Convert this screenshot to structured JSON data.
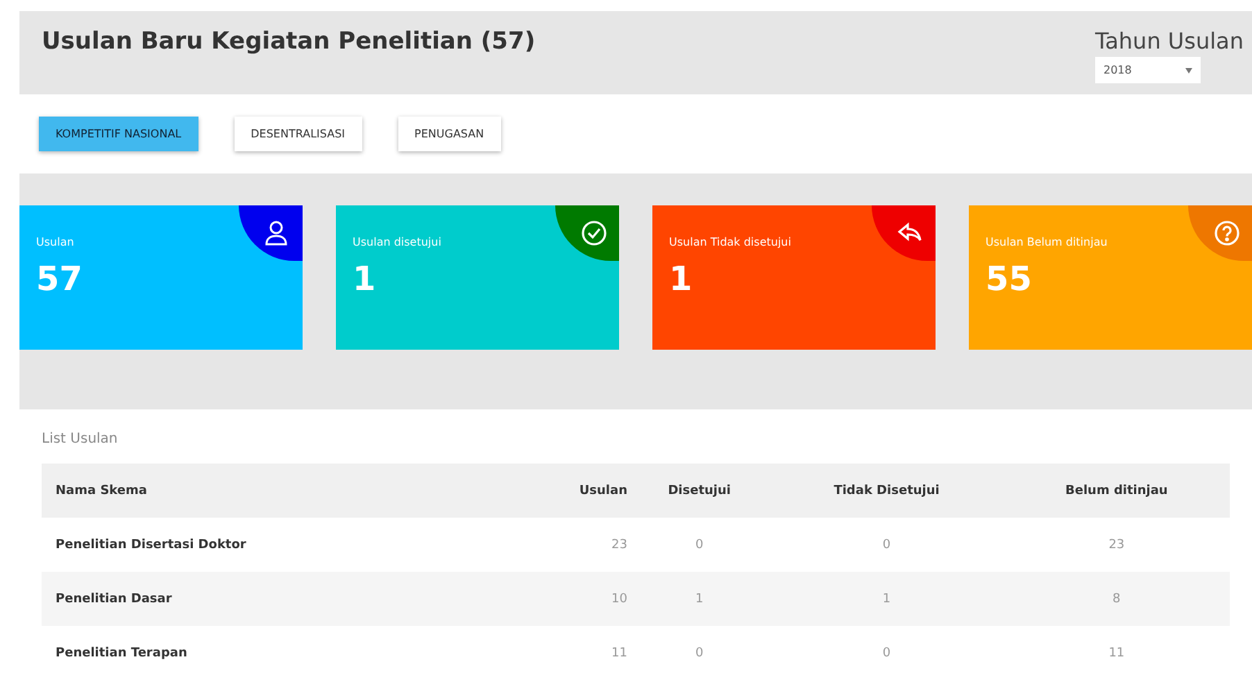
{
  "title": "Usulan Baru Kegiatan Penelitian (57)",
  "year_filter": {
    "label": "Tahun Usulan",
    "value": "2018"
  },
  "tabs": [
    {
      "label": "KOMPETITIF NASIONAL",
      "selected": true
    },
    {
      "label": "DESENTRALISASI",
      "selected": false
    },
    {
      "label": "PENUGASAN",
      "selected": false
    }
  ],
  "cards": [
    {
      "kind": "user",
      "label": "Usulan",
      "value": "57",
      "color": "#00bfff"
    },
    {
      "kind": "check",
      "label": "Usulan disetujui",
      "value": "1",
      "color": "#00cccc"
    },
    {
      "kind": "reply",
      "label": "Usulan Tidak disetujui",
      "value": "1",
      "color": "#ff4500"
    },
    {
      "kind": "question",
      "label": "Usulan Belum ditinjau",
      "value": "55",
      "color": "#ffa500"
    }
  ],
  "table": {
    "title": "List Usulan",
    "columns": [
      "Nama Skema",
      "Usulan",
      "Disetujui",
      "Tidak Disetujui",
      "Belum ditinjau"
    ],
    "rows": [
      [
        "Penelitian Disertasi Doktor",
        "23",
        "0",
        "0",
        "23"
      ],
      [
        "Penelitian Dasar",
        "10",
        "1",
        "1",
        "8"
      ],
      [
        "Penelitian Terapan",
        "11",
        "0",
        "0",
        "11"
      ]
    ]
  }
}
